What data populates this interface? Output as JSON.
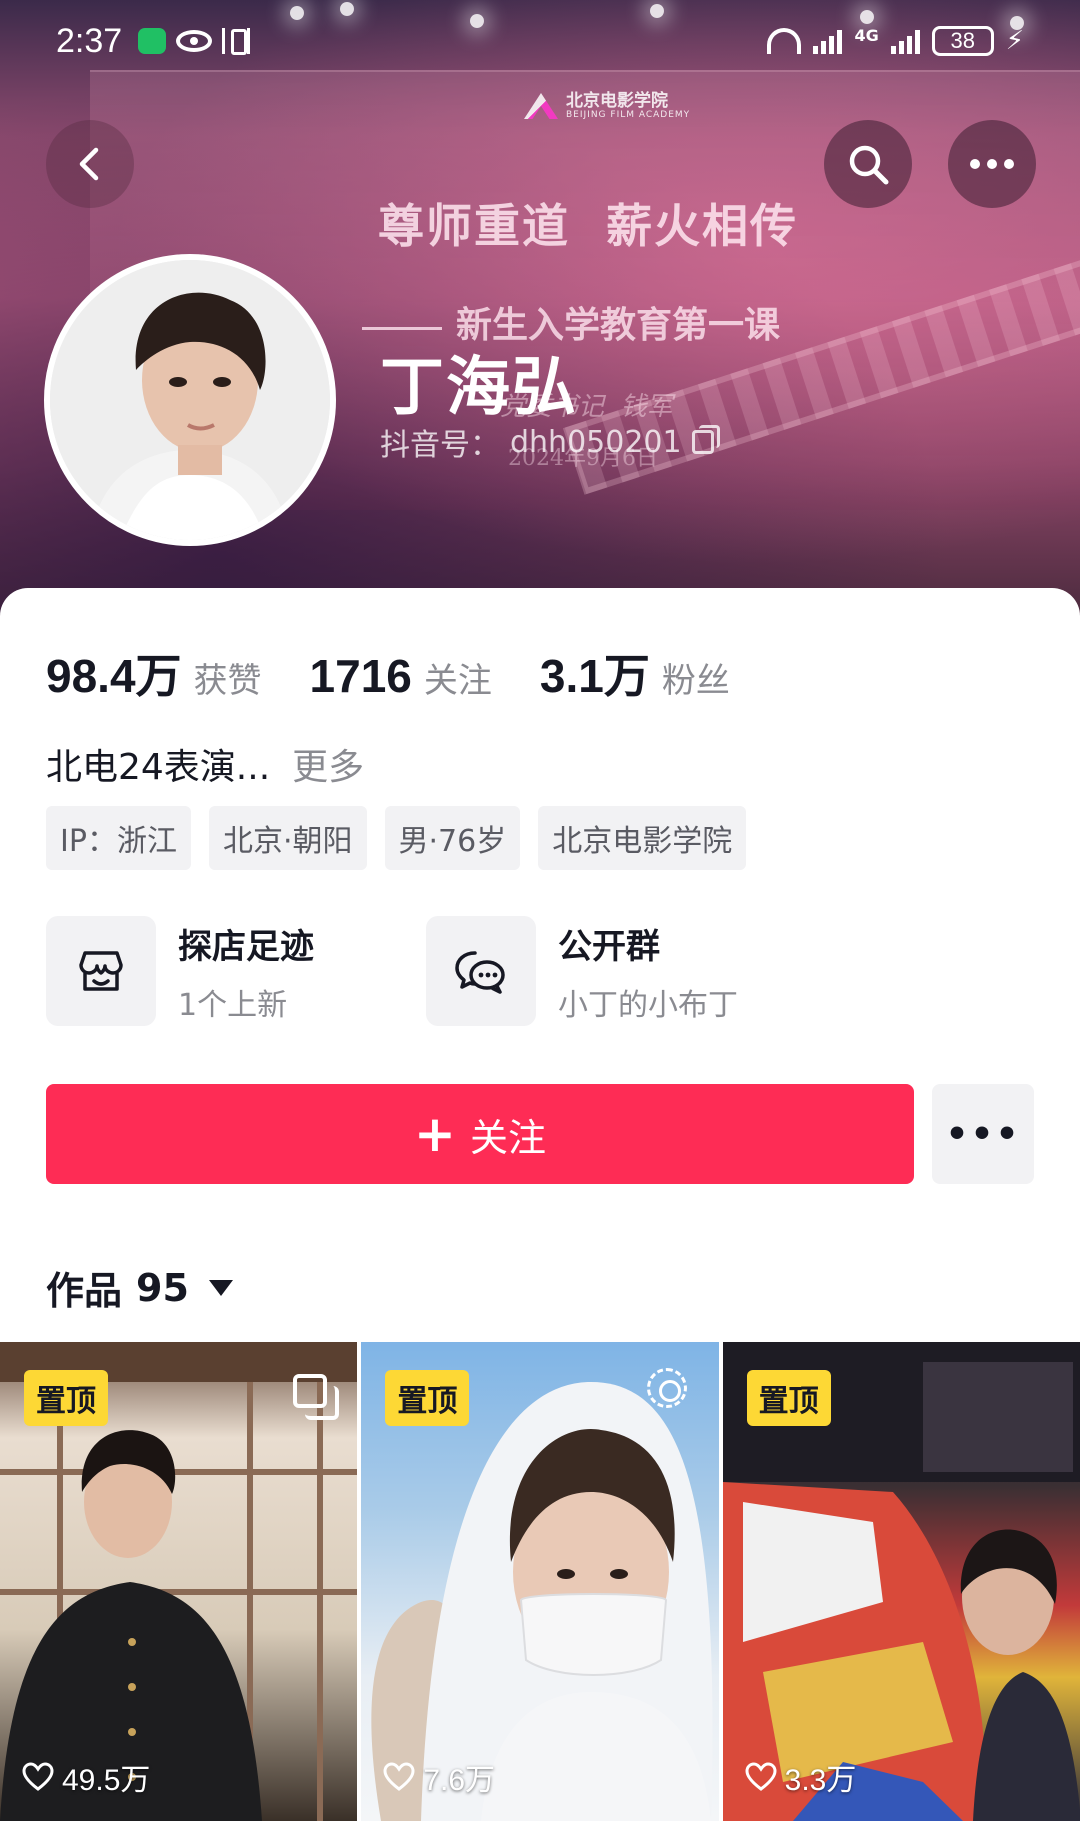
{
  "status_bar": {
    "time": "2:37",
    "network": "4G",
    "battery": "38"
  },
  "banner": {
    "school_cn": "北京电影学院",
    "school_en": "BEIJING FILM ACADEMY",
    "motto": "尊师重道  薪火相传",
    "subtitle": "新生入学教育第一课",
    "signature": "党委书记  钱军",
    "date": "2024年9月6日"
  },
  "profile": {
    "name": "丁海弘",
    "douyin_id_label": "抖音号：",
    "douyin_id": "dhh050201"
  },
  "stats": [
    {
      "value": "98.4万",
      "label": "获赞"
    },
    {
      "value": "1716",
      "label": "关注"
    },
    {
      "value": "3.1万",
      "label": "粉丝"
    }
  ],
  "bio": {
    "text": "北电24表演...",
    "more": "更多"
  },
  "tags": [
    "IP：浙江",
    "北京·朝阳",
    "男·76岁",
    "北京电影学院"
  ],
  "features": [
    {
      "icon": "store-icon",
      "title": "探店足迹",
      "subtitle": "1个上新"
    },
    {
      "icon": "group-chat-icon",
      "title": "公开群",
      "subtitle": "小丁的小布丁"
    }
  ],
  "actions": {
    "follow_label": "关注",
    "more_label": "•••"
  },
  "works": {
    "label": "作品",
    "count": "95"
  },
  "grid": [
    {
      "pin": "置顶",
      "likes": "49.5万",
      "type_icon": "multi-image-icon"
    },
    {
      "pin": "置顶",
      "likes": "7.6万",
      "type_icon": "live-photo-icon"
    },
    {
      "pin": "置顶",
      "likes": "3.3万",
      "type_icon": ""
    }
  ],
  "colors": {
    "accent": "#fe2c55",
    "pin_badge": "#fdd835",
    "secondary_text": "#8a8b91"
  }
}
